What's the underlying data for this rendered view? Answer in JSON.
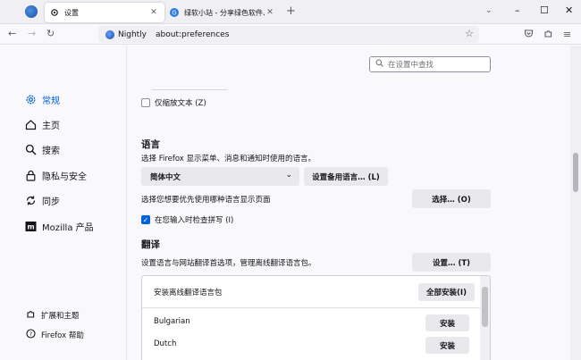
{
  "tabs": [
    {
      "title": "设置",
      "icon": "gear-icon"
    },
    {
      "title": "绿软小站 - 分享绿色软件、免费",
      "icon": "site-favicon-icon"
    }
  ],
  "window": {
    "minimize": "–",
    "maximize": "☐",
    "close": "✕"
  },
  "navbar": {
    "identity": "Nightly",
    "url": "about:preferences"
  },
  "sidebar": {
    "items": [
      {
        "label": "常规"
      },
      {
        "label": "主页"
      },
      {
        "label": "搜索"
      },
      {
        "label": "隐私与安全"
      },
      {
        "label": "同步"
      },
      {
        "label": "Mozilla 产品"
      }
    ],
    "bottom": [
      {
        "label": "扩展和主题"
      },
      {
        "label": "Firefox 帮助"
      }
    ]
  },
  "search": {
    "placeholder": "在设置中查找"
  },
  "main": {
    "zoom_text_only": "仅缩放文本 (Z)",
    "language": {
      "heading": "语言",
      "description": "选择 Firefox 显示菜单、消息和通知时使用的语言。",
      "selected_language": "简体中文",
      "alternatives_button": "设置备用语言… (L)",
      "page_language_description": "选择您想要优先使用哪种语言显示页面",
      "choose_button": "选择… (O)",
      "spellcheck": "在您输入时检查拼写 (I)"
    },
    "translation": {
      "heading": "翻译",
      "description": "设置语言与网站翻译首选项，管理离线翻译语言包。",
      "settings_button": "设置… (T)",
      "install_all_label": "安装离线翻译语言包",
      "install_all_button": "全部安装(I)",
      "languages": [
        {
          "name": "Bulgarian",
          "button": "安装"
        },
        {
          "name": "Dutch",
          "button": "安装"
        }
      ]
    }
  },
  "colors": {
    "accent": "#0061e0",
    "button_bg": "#e9e9ed"
  }
}
